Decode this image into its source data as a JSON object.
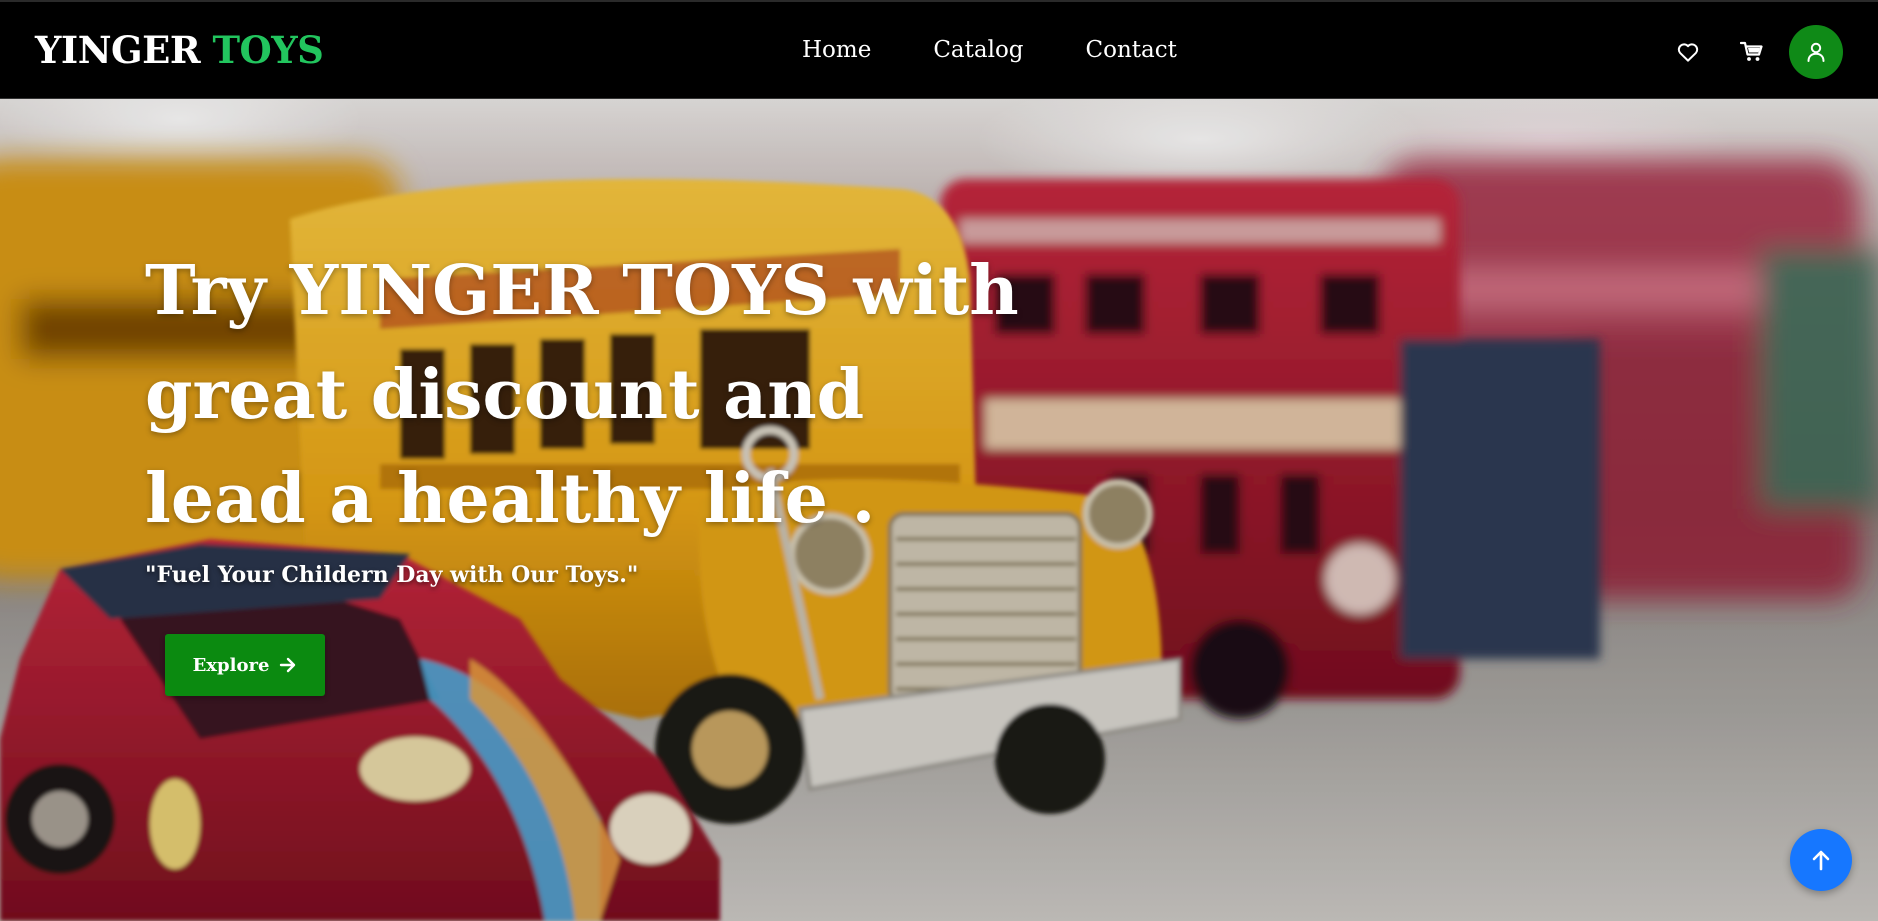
{
  "brand": {
    "part1": "YINGER",
    "part2": "TOYS"
  },
  "nav": {
    "links": [
      {
        "label": "Home"
      },
      {
        "label": "Catalog"
      },
      {
        "label": "Contact"
      }
    ],
    "icons": [
      "heart-icon",
      "cart-icon",
      "user-icon"
    ]
  },
  "hero": {
    "title": "Try YINGER TOYS with great discount and lead a healthy life .",
    "subtitle": "\"Fuel Your Childern Day with Our Toys.\"",
    "cta_label": "Explore",
    "cta_icon": "arrow-right-icon"
  },
  "scroll_top_icon": "arrow-up-icon",
  "colors": {
    "navbar_bg": "#000000",
    "brand_accent": "#22c55e",
    "avatar_bg": "#0f8a17",
    "cta_bg": "#0b8a10",
    "scroll_top_bg": "#1677ff"
  }
}
